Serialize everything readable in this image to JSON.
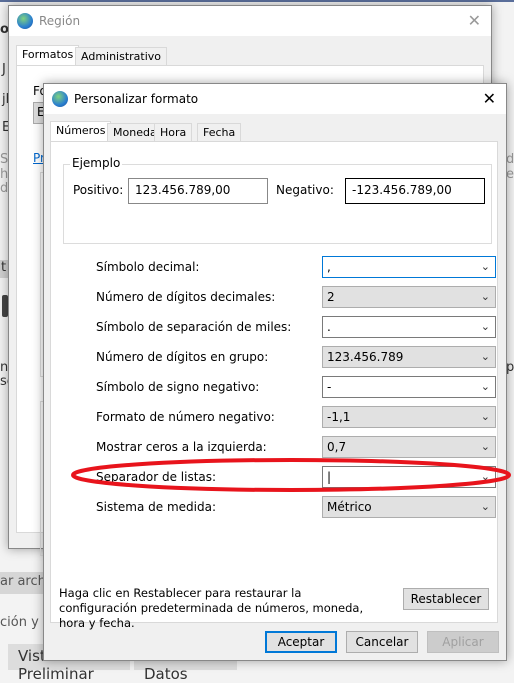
{
  "background": {
    "fragments_left": [
      "o",
      "J",
      "jh",
      "E",
      "Pr",
      "Se",
      "hi",
      "de",
      "t",
      "nd",
      "se"
    ],
    "fragments_right": [
      "de",
      "e",
      "pe"
    ],
    "bottom_text_1": "ar arch",
    "bottom_text_2": "ción y",
    "buttons": [
      "Vista Preliminar",
      "Enviar Datos"
    ]
  },
  "region_window": {
    "title": "Región",
    "tabs": [
      {
        "label": "Formatos",
        "active": true
      },
      {
        "label": "Administrativo",
        "active": false
      }
    ],
    "fragments": [
      "Fo",
      "Es"
    ]
  },
  "custom_format_window": {
    "title": "Personalizar formato",
    "tabs": [
      {
        "label": "Números",
        "active": true
      },
      {
        "label": "Moneda"
      },
      {
        "label": "Hora"
      },
      {
        "label": "Fecha"
      }
    ],
    "example": {
      "legend": "Ejemplo",
      "positive_label": "Positivo:",
      "positive_value": "123.456.789,00",
      "negative_label": "Negativo:",
      "negative_value": "-123.456.789,00"
    },
    "settings": [
      {
        "label": "Símbolo decimal:",
        "value": ",",
        "editable": true
      },
      {
        "label": "Número de dígitos decimales:",
        "value": "2",
        "editable": false
      },
      {
        "label": "Símbolo de separación de miles:",
        "value": ".",
        "editable": true
      },
      {
        "label": "Número de dígitos en grupo:",
        "value": "123.456.789",
        "editable": false
      },
      {
        "label": "Símbolo de signo negativo:",
        "value": "-",
        "editable": true
      },
      {
        "label": "Formato de número negativo:",
        "value": "-1,1",
        "editable": false
      },
      {
        "label": "Mostrar ceros a la izquierda:",
        "value": "0,7",
        "editable": false
      },
      {
        "label": "Separador de listas:",
        "value": "|",
        "editable": true
      },
      {
        "label": "Sistema de medida:",
        "value": "Métrico",
        "editable": false
      }
    ],
    "reset_help": "Haga clic en Restablecer para restaurar la configuración predeterminada de números, moneda, hora y fecha.",
    "reset_label": "Restablecer",
    "ok_label": "Aceptar",
    "cancel_label": "Cancelar",
    "apply_label": "Aplicar",
    "annotation_color": "#e8141c",
    "accent": "#0078d7"
  }
}
